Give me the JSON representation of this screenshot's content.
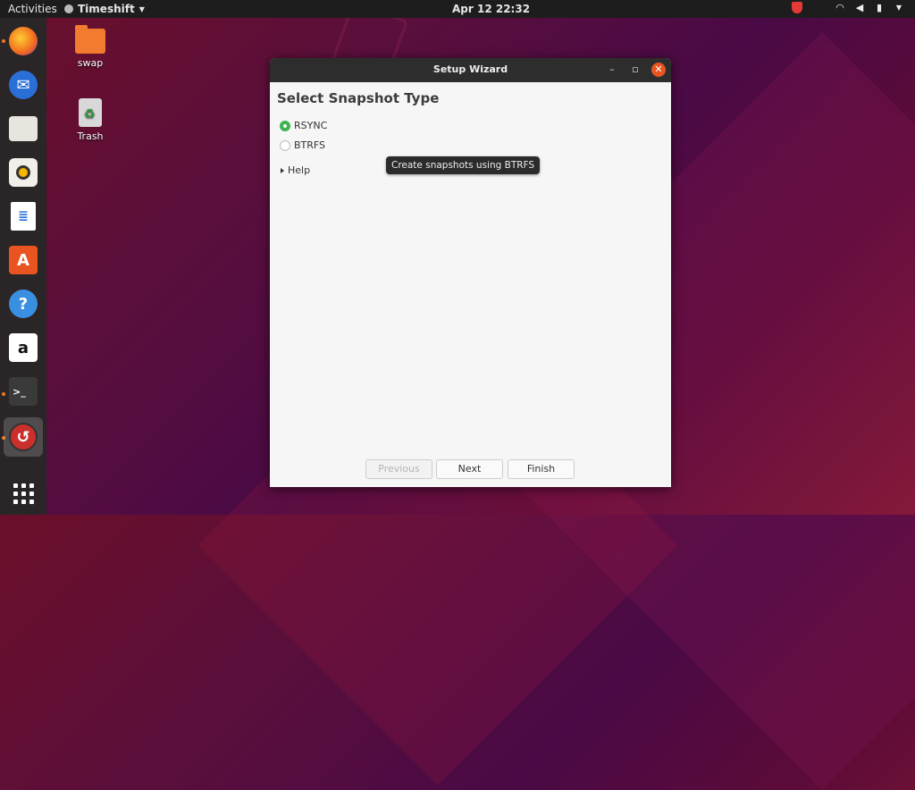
{
  "topbar": {
    "activities": "Activities",
    "app_name": "Timeshift",
    "clock": "Apr 12  22:32"
  },
  "desktop": {
    "icons": [
      {
        "label": "swap"
      },
      {
        "label": "Trash"
      }
    ]
  },
  "dock": {
    "items": [
      "firefox-icon",
      "thunderbird-icon",
      "files-icon",
      "rhythmbox-icon",
      "writer-icon",
      "software-icon",
      "help-icon",
      "amazon-icon",
      "terminal-icon",
      "timeshift-icon",
      "show-apps-icon"
    ]
  },
  "window": {
    "title": "Setup Wizard",
    "heading": "Select Snapshot Type",
    "options": [
      {
        "label": "RSYNC",
        "selected": true
      },
      {
        "label": "BTRFS",
        "selected": false
      }
    ],
    "help_label": "Help",
    "tooltip": "Create snapshots using BTRFS",
    "buttons": {
      "previous": "Previous",
      "next": "Next",
      "finish": "Finish"
    }
  },
  "colors": {
    "accent": "#e95420",
    "radio_selected": "#3eb34f"
  }
}
